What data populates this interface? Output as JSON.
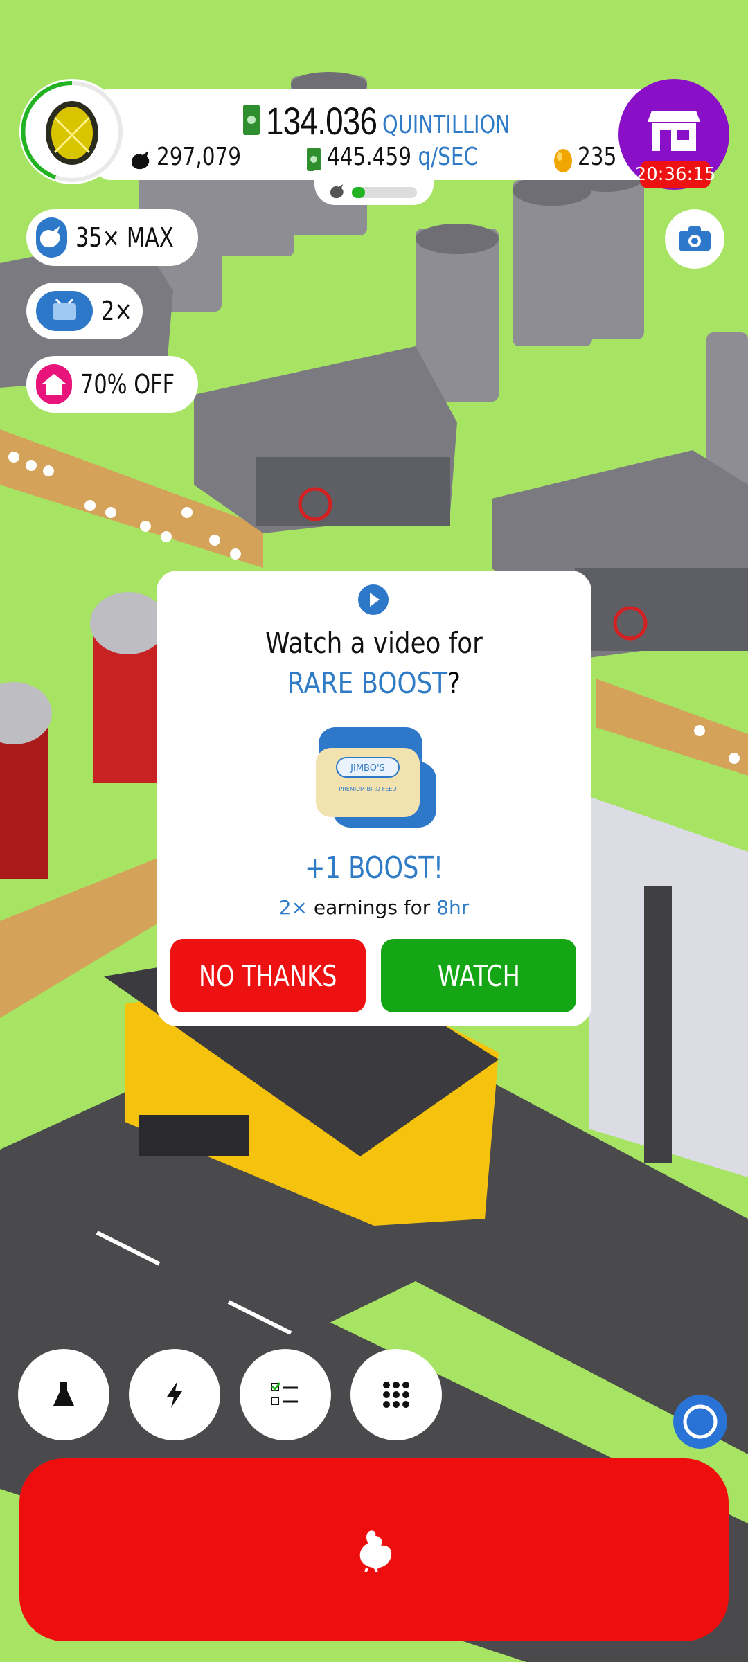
{
  "header": {
    "money_value": "134.036",
    "money_unit": "QUINTILLION",
    "chickens": "297,079",
    "income_value": "445.459",
    "income_unit": "q/SEC",
    "golden_eggs": "235",
    "shop_timer": "20:36:15",
    "hatchery_progress": 0.2
  },
  "boosts": [
    {
      "label": "35× MAX",
      "icon": "chicken-icon",
      "color": "#2e78c9"
    },
    {
      "label": "2×",
      "icon": "tv-icon",
      "color": "#2e78c9"
    },
    {
      "label": "70% OFF",
      "icon": "house-icon",
      "color": "#e8147c"
    }
  ],
  "dialog": {
    "title": "Watch a video for",
    "subtitle_highlight": "RARE BOOST",
    "subtitle_end": "?",
    "item_brand": "JIMBO'S",
    "item_caption": "PREMIUM BIRD FEED",
    "boost_text": "+1 BOOST!",
    "earn_multiplier": "2×",
    "earn_mid": "earnings for",
    "earn_duration": "8hr",
    "no_label": "NO THANKS",
    "yes_label": "WATCH"
  },
  "colors": {
    "grass": "#a8e463",
    "accent_blue": "#2f7bc6",
    "button_red": "#ee1111",
    "button_green": "#14a614",
    "shop_purple": "#8a10c8"
  },
  "bottom_icons": [
    "flask-icon",
    "lightning-icon",
    "checklist-icon",
    "grid-icon"
  ]
}
